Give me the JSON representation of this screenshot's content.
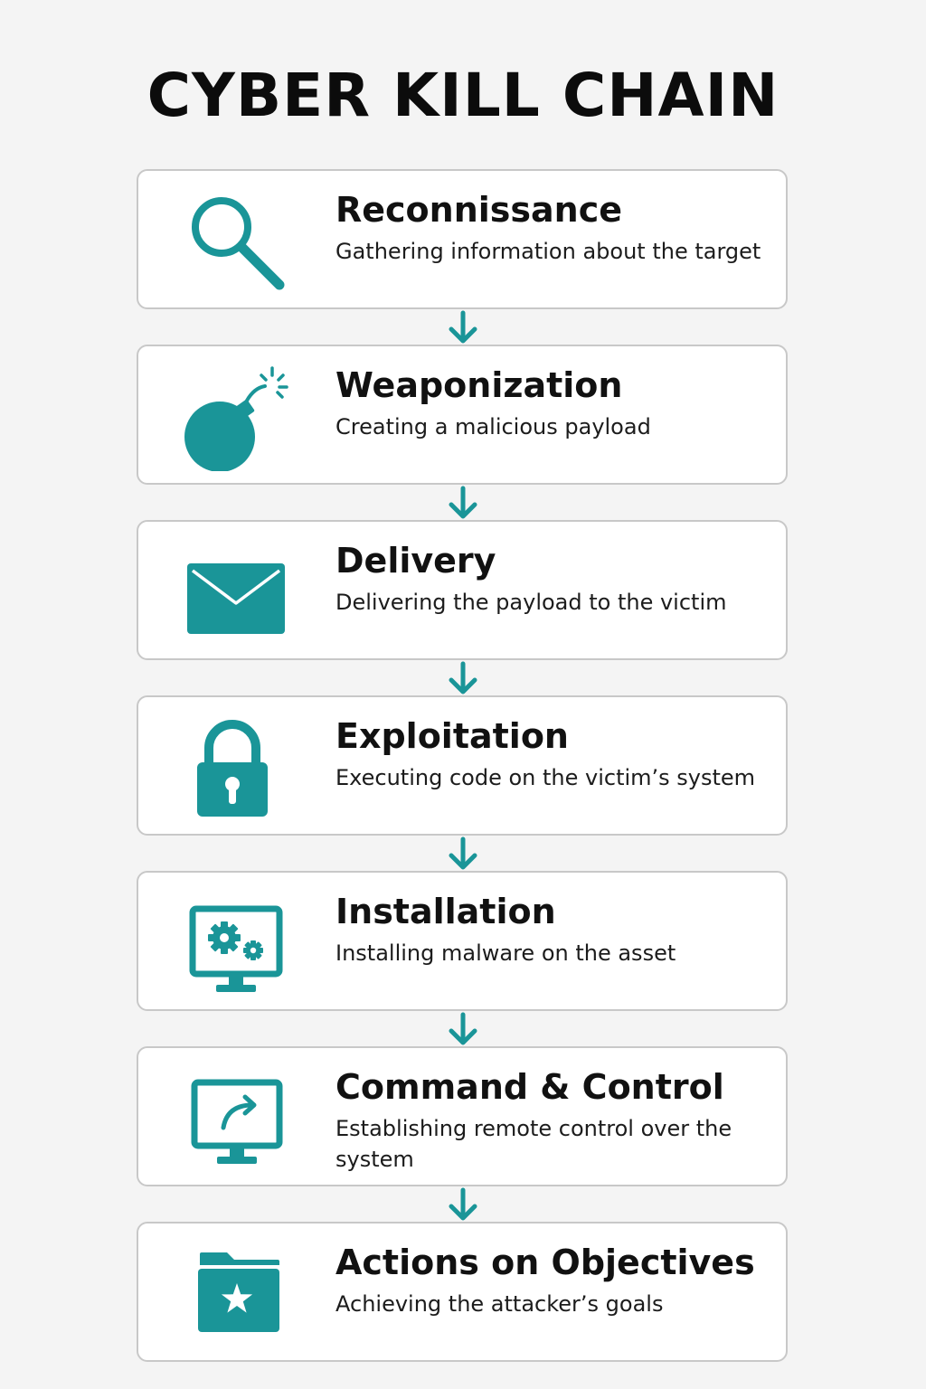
{
  "title": "CYBER KILL CHAIN",
  "accent_color": "#1a9598",
  "steps": [
    {
      "icon": "magnifier-icon",
      "title": "Reconnissance",
      "description": "Gathering information about the target"
    },
    {
      "icon": "bomb-icon",
      "title": "Weaponization",
      "description": "Creating a malicious  payload"
    },
    {
      "icon": "envelope-icon",
      "title": "Delivery",
      "description": "Delivering the payload to the victim"
    },
    {
      "icon": "padlock-icon",
      "title": "Exploitation",
      "description": "Executing code on the victim’s system"
    },
    {
      "icon": "monitor-gears-icon",
      "title": "Installation",
      "description": "Installing malware  on the asset"
    },
    {
      "icon": "monitor-arrow-icon",
      "title": "Command & Control",
      "description": "Establishing remote control over the system"
    },
    {
      "icon": "folder-star-icon",
      "title": "Actions on Objectives",
      "description": "Achieving the attacker’s goals"
    }
  ]
}
